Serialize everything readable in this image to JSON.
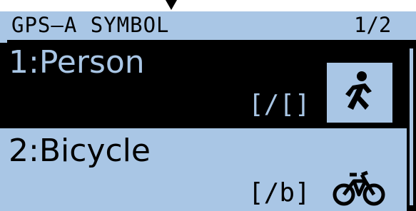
{
  "header": {
    "title": "GPS–A SYMBOL",
    "page": "1/2"
  },
  "items": [
    {
      "label": "1:Person",
      "code": "[/[]",
      "icon": "person-walking-icon",
      "selected": true
    },
    {
      "label": "2:Bicycle",
      "code": "[/b]",
      "icon": "bicycle-icon",
      "selected": false
    }
  ],
  "colors": {
    "lcd_background": "#a9c6e5",
    "text": "#000000",
    "selection": "#000000"
  }
}
